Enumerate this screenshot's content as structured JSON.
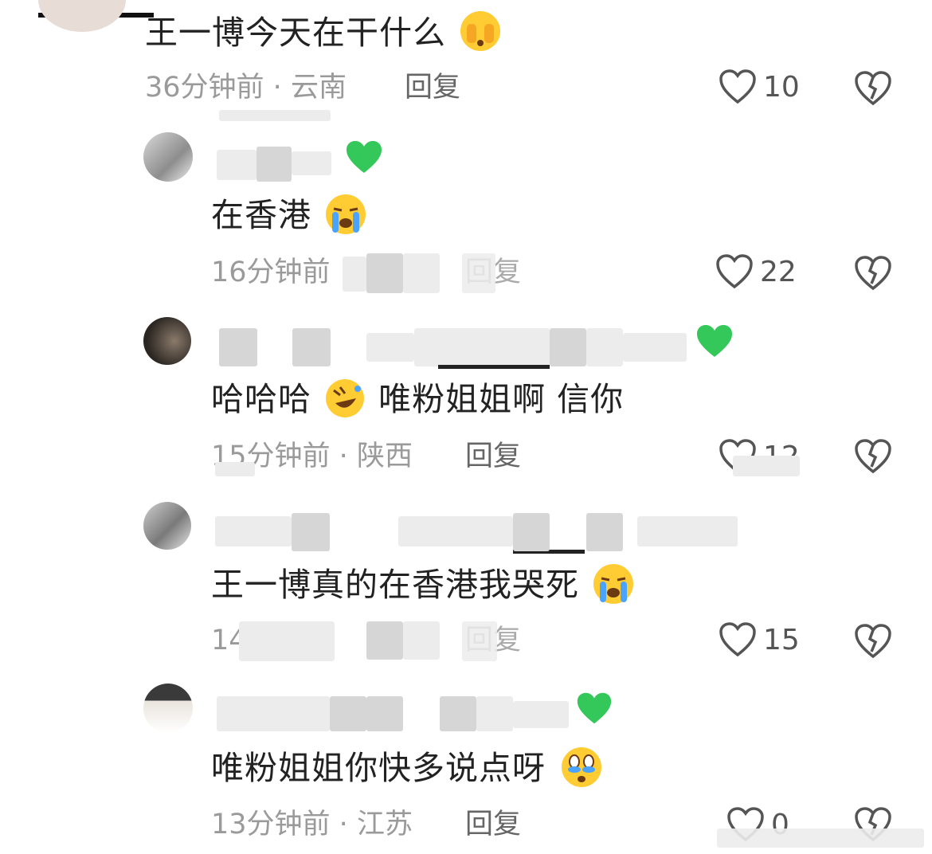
{
  "comments": [
    {
      "text": "王一博今天在干什么",
      "time": "36分钟前",
      "location": "云南",
      "reply_label": "回复",
      "likes": "10",
      "emoji": "face-peeking-icon"
    },
    {
      "text": "在香港",
      "time": "16分钟前",
      "location": "",
      "reply_label": "回复",
      "likes": "22",
      "emoji": "loudly-crying-face-icon"
    },
    {
      "text_before": "哈哈哈",
      "text_after": "唯粉姐姐啊 信你",
      "time": "15分钟前",
      "location": "陕西",
      "reply_label": "回复",
      "likes": "12",
      "emoji": "rolling-on-floor-laughing-icon"
    },
    {
      "text": "王一博真的在香港我哭死",
      "time": "14分钟前",
      "location": "",
      "reply_label": "回复",
      "likes": "15",
      "emoji": "loudly-crying-face-icon"
    },
    {
      "text": "唯粉姐姐你快多说点呀",
      "time": "13分钟前",
      "location": "江苏",
      "reply_label": "回复",
      "likes": "0",
      "emoji": "face-holding-back-tears-icon"
    }
  ],
  "separator": " · ",
  "colors": {
    "green_heart": "#34c759",
    "emoji_yellow": "#ffcc33",
    "tear_blue": "#4aa3ff",
    "meta_gray": "#9a9a9a"
  }
}
